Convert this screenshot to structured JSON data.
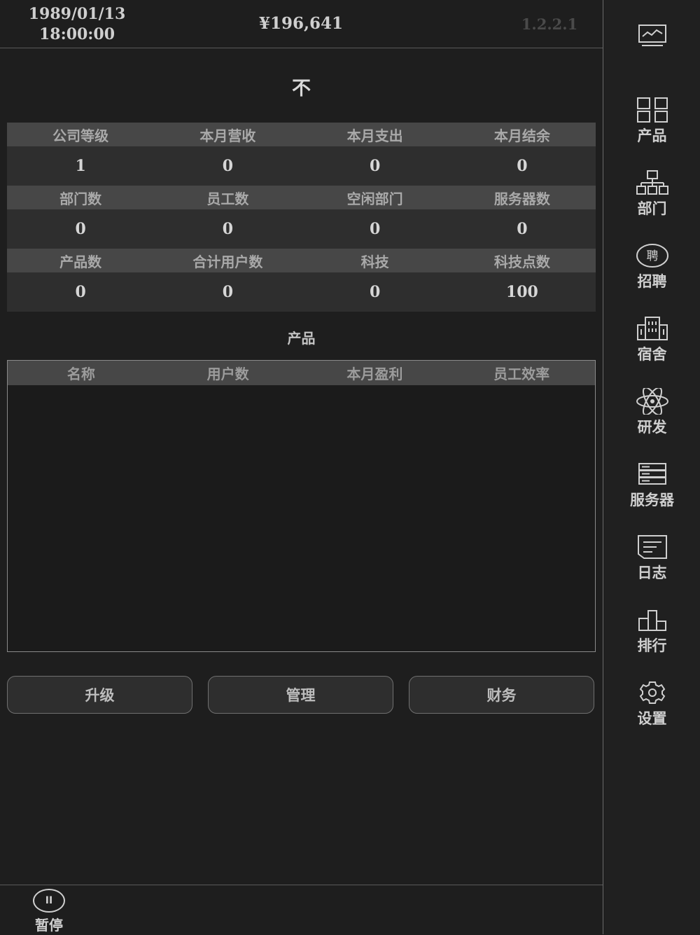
{
  "header": {
    "date": "1989/01/13",
    "time": "18:00:00",
    "money": "¥196,641",
    "version": "1.2.2.1"
  },
  "company_name": "不",
  "stats": {
    "row1_labels": [
      "公司等级",
      "本月营收",
      "本月支出",
      "本月结余"
    ],
    "row1_values": [
      "1",
      "0",
      "0",
      "0"
    ],
    "row2_labels": [
      "部门数",
      "员工数",
      "空闲部门",
      "服务器数"
    ],
    "row2_values": [
      "0",
      "0",
      "0",
      "0"
    ],
    "row3_labels": [
      "产品数",
      "合计用户数",
      "科技",
      "科技点数"
    ],
    "row3_values": [
      "0",
      "0",
      "0",
      "100"
    ]
  },
  "products": {
    "title": "产品",
    "columns": [
      "名称",
      "用户数",
      "本月盈利",
      "员工效率"
    ],
    "rows": []
  },
  "buttons": {
    "upgrade": "升级",
    "manage": "管理",
    "finance": "财务"
  },
  "pause": {
    "label": "暂停"
  },
  "sidebar": {
    "items": [
      {
        "label": "",
        "icon": "monitor-chart-icon"
      },
      {
        "label": "产品",
        "icon": "grid-icon"
      },
      {
        "label": "部门",
        "icon": "org-chart-icon"
      },
      {
        "label": "招聘",
        "icon": "hire-badge-icon",
        "badge": "聘"
      },
      {
        "label": "宿舍",
        "icon": "building-icon"
      },
      {
        "label": "研发",
        "icon": "atom-icon"
      },
      {
        "label": "服务器",
        "icon": "server-icon"
      },
      {
        "label": "日志",
        "icon": "log-icon"
      },
      {
        "label": "排行",
        "icon": "podium-icon"
      },
      {
        "label": "设置",
        "icon": "gear-icon"
      }
    ]
  }
}
